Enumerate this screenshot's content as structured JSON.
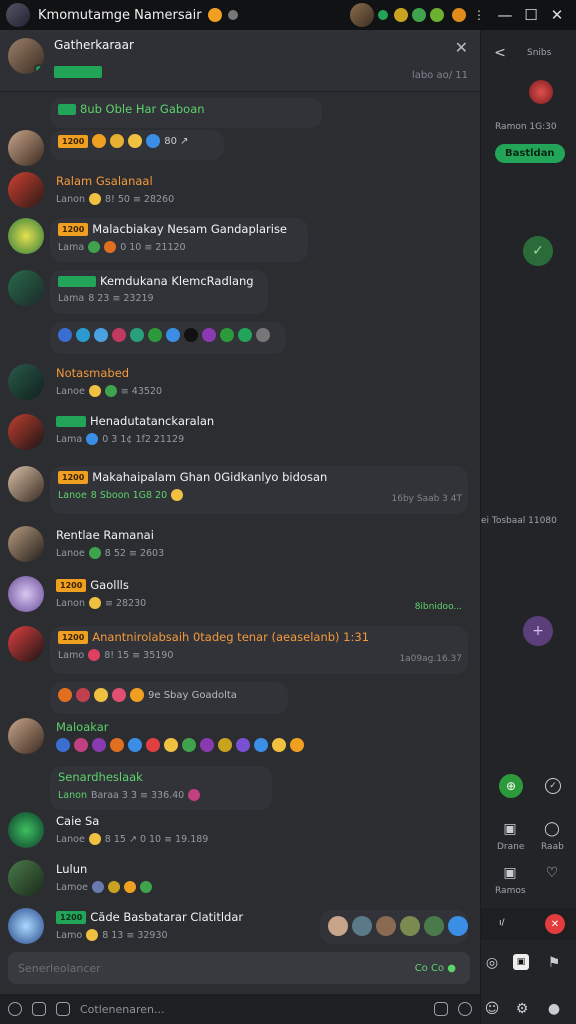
{
  "window": {
    "title": "Kmomutamge Namersair",
    "buttons": {
      "minimize": "—",
      "maximize": "☐",
      "close": "✕"
    }
  },
  "colors": {
    "accent_green": "#23a559",
    "accent_orange": "#f0a020",
    "bg_main": "#2b2d31",
    "bg_side": "#232428",
    "danger": "#e23c3c",
    "purple": "#7a4f9a"
  },
  "chat_header": {
    "name": "Gatherkaraar",
    "badge": "",
    "time": "labo ao/ 11",
    "close": "✕"
  },
  "messages": [
    {
      "title": "8ub Oble Har Gaboan",
      "badge": "",
      "sub": "",
      "time": ""
    },
    {
      "title": "",
      "badge": "1200",
      "sub": "80  ↗",
      "time": ""
    },
    {
      "title": "Ralam Gsalanaal",
      "badge": "",
      "sub_label": "Lanon",
      "sub": "8! 50   ≡ 28260",
      "time": ""
    },
    {
      "title": "Malacbiakay Nesam Gandaplarise",
      "badge": "1200",
      "sub_label": "Lama",
      "sub": "0 10  ≡ 21120",
      "time": ""
    },
    {
      "title": "Kemdukana KlemcRadlang",
      "badge": "",
      "sub_label": "Lama",
      "sub": "8 23  ≡ 23219",
      "time": ""
    },
    {
      "title": "",
      "badge": "",
      "sub": "",
      "time": ""
    },
    {
      "title": "Notasmabed",
      "badge": "",
      "sub_label": "Lanoe",
      "sub": "≡ 43520",
      "time": ""
    },
    {
      "title": "Henadutatanckaralan",
      "badge": "",
      "sub_label": "Lama",
      "sub": "0 3  1¢ 1f2  21129",
      "time": ""
    },
    {
      "title": "Makahaipalam Ghan 0Gidkanlyo bidosan",
      "badge": "1200",
      "sub_label": "Lanoe",
      "sub": "8 Sboon   1G8 20",
      "time": "16by Saab  3 4T"
    },
    {
      "title": "Rentlae Ramanai",
      "badge": "",
      "sub_label": "Lanoe",
      "sub": "8 52   ≡ 2603",
      "time": ""
    },
    {
      "title": "Gaollls",
      "badge": "1200",
      "sub_label": "Lanon",
      "sub": "≡ 28230",
      "time": "8ibnidoo..."
    },
    {
      "title": "Anantnirolabsaih 0tadeg tenar (aeaselanb) 1:31",
      "badge": "1200",
      "sub_label": "Lamo",
      "sub": "8! 15   ≡ 35190",
      "time": "1a09ag.16.37"
    },
    {
      "title": "9e Sbay Goadolta",
      "badge": "",
      "sub": "",
      "time": ""
    },
    {
      "title": "Maloakar",
      "badge": "",
      "sub": "",
      "time": ""
    },
    {
      "title": "Senardheslaak",
      "badge": "",
      "sub_label": "Lanon",
      "sub": "Baraa 3 3   ≡ 336.40",
      "time": ""
    },
    {
      "title": "Caie Sa",
      "badge": "",
      "sub_label": "Lanoe",
      "sub": "8 15  ↗ 0 10  ≡ 19.189",
      "time": ""
    },
    {
      "title": "Lulun",
      "badge": "",
      "sub_label": "Lamoe",
      "sub": "",
      "time": ""
    },
    {
      "title": "Căde Basbatarar Clatitldar",
      "badge": "1200",
      "sub_label": "Lamo",
      "sub": "8 13   ≡ 32930",
      "time": ""
    }
  ],
  "composer": {
    "value": "",
    "placeholder": "Senerleolancer",
    "counter": "Co Co ●"
  },
  "bottom_bar": {
    "text": "Cotlenenaren..."
  },
  "right_panel": {
    "back": "<",
    "title": "Snibs",
    "time": "Ramon 1G:30",
    "pill": "Bastldan",
    "mid_time": "ei Tosbaal 11080",
    "bottom_labels": [
      "Drane",
      "Raab",
      "Ramos"
    ],
    "danger_label": "✕"
  }
}
